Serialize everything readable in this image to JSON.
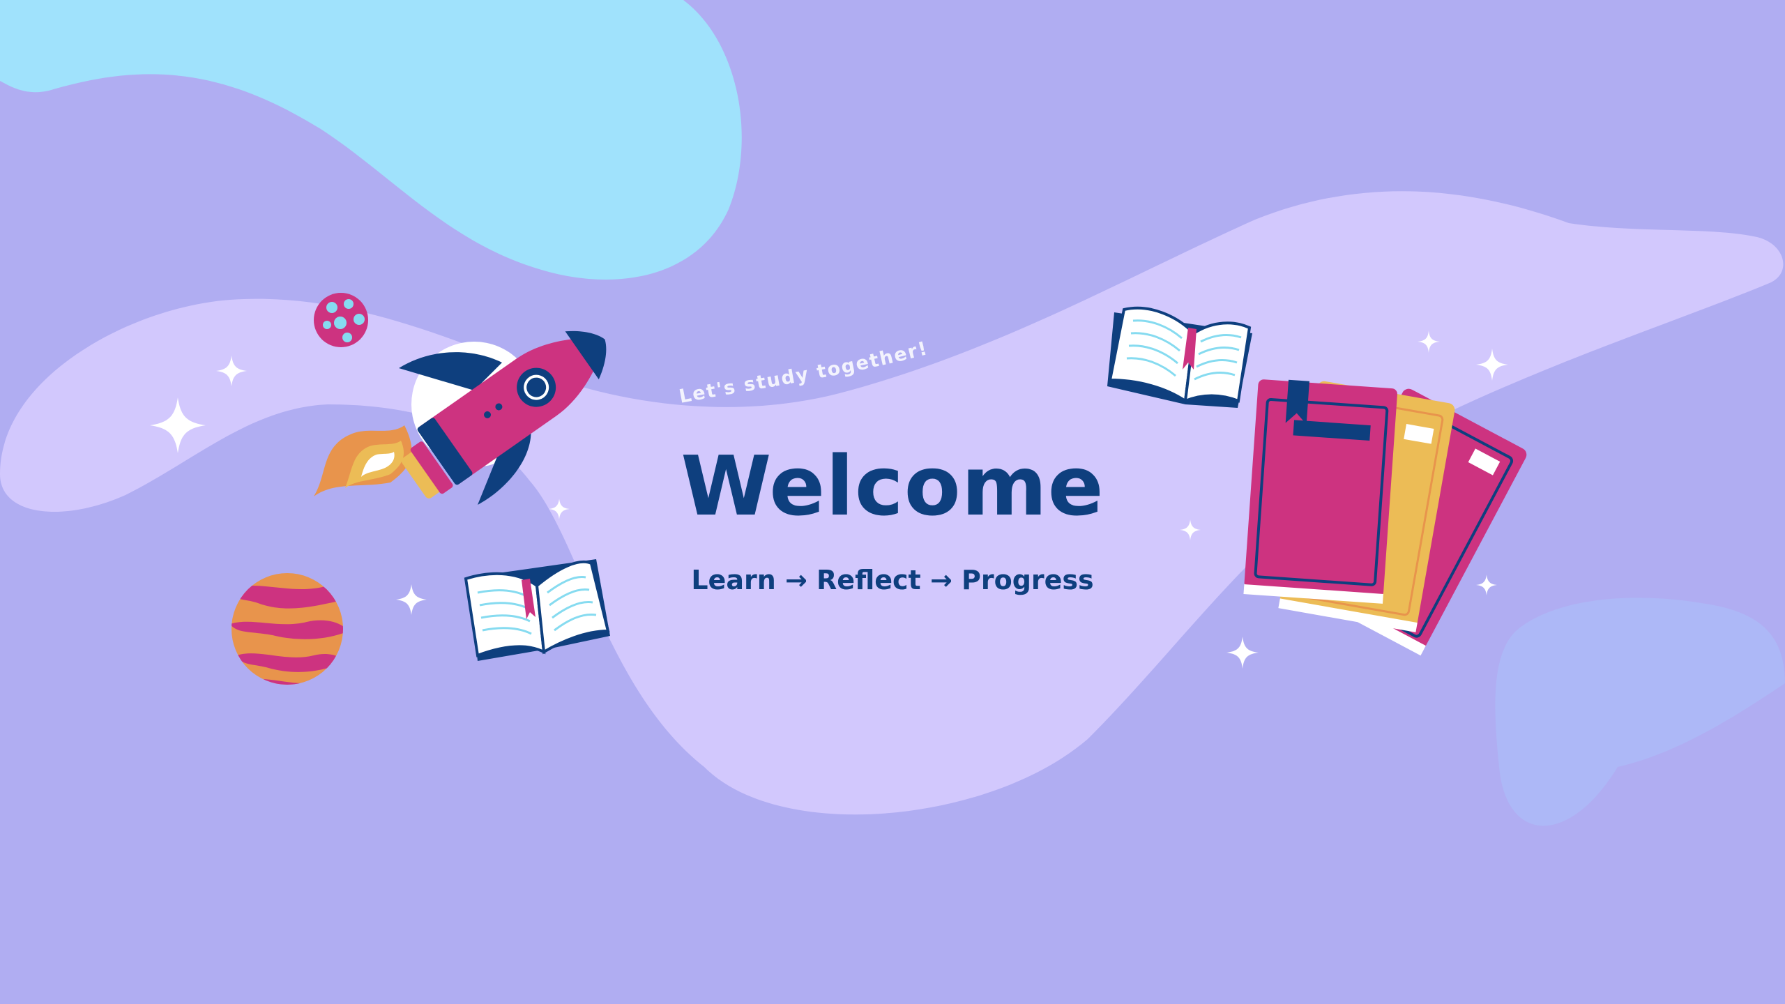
{
  "banner": {
    "tagline": "Let's study together!",
    "title": "Welcome",
    "subtitle": "Learn → Reflect → Progress"
  },
  "colors": {
    "background": "#b0adf2",
    "wave": "#d2c8fd",
    "sky_blob": "#a0e2fc",
    "corner_blob": "#adb8f7",
    "navy": "#0e3f7e",
    "magenta": "#cd3380",
    "mustard": "#ecbc56",
    "orange": "#e8944c",
    "white": "#ffffff"
  },
  "icons": [
    "rocket-icon",
    "moon-icon",
    "planet-icon",
    "open-book-icon",
    "book-stack-icon",
    "sparkle-icon"
  ]
}
